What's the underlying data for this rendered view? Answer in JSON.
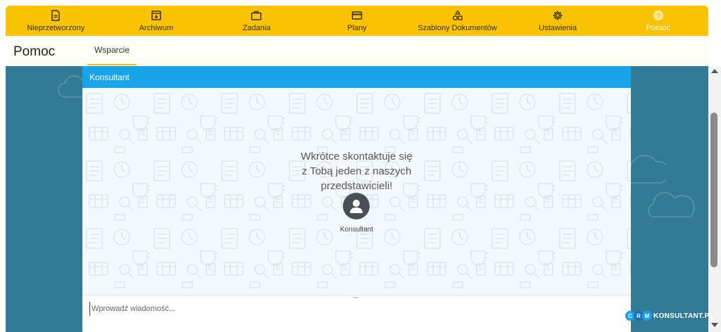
{
  "nav": {
    "items": [
      {
        "label": "Nieprzetworzony",
        "icon": "document-icon"
      },
      {
        "label": "Archiwum",
        "icon": "archive-icon"
      },
      {
        "label": "Zadania",
        "icon": "briefcase-icon"
      },
      {
        "label": "Plany",
        "icon": "card-icon"
      },
      {
        "label": "Szablony Dokumentów",
        "icon": "shapes-icon"
      },
      {
        "label": "Ustawienia",
        "icon": "gear-icon"
      },
      {
        "label": "Pomoc",
        "icon": "help-icon",
        "active": true
      }
    ]
  },
  "page": {
    "title": "Pomoc",
    "tab": "Wsparcie"
  },
  "chat": {
    "header": "Konsultant",
    "message_line1": "Wkrótce skontaktuje się",
    "message_line2": "z Tobą jeden z naszych",
    "message_line3": "przedstawicieli!",
    "avatar_label": "Konsultant",
    "input_placeholder": "Wprowadź wiadomość..."
  },
  "brand": {
    "c1": "C",
    "c2": "R",
    "c3": "M",
    "text": "KONSULTANT.PL"
  },
  "colors": {
    "nav_bg": "#fcc204",
    "chat_header": "#19a3ea",
    "side_bg": "#327b96"
  }
}
